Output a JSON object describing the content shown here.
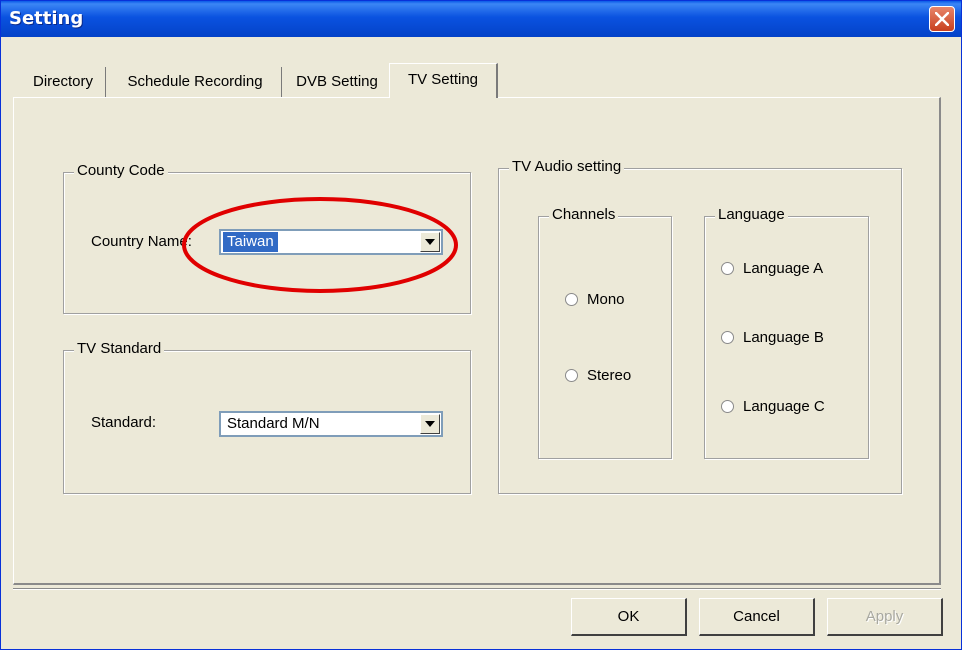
{
  "window": {
    "title": "Setting"
  },
  "tabs": [
    {
      "label": "Directory"
    },
    {
      "label": "Schedule Recording"
    },
    {
      "label": "DVB Setting"
    },
    {
      "label": "TV Setting",
      "active": true
    }
  ],
  "country_group": {
    "legend": "County Code",
    "country_label": "Country Name:",
    "country_value": "Taiwan"
  },
  "standard_group": {
    "legend": "TV Standard",
    "standard_label": "Standard:",
    "standard_value": "Standard M/N"
  },
  "audio_group": {
    "legend": "TV Audio setting",
    "channels": {
      "legend": "Channels",
      "options": [
        "Mono",
        "Stereo"
      ]
    },
    "language": {
      "legend": "Language",
      "options": [
        "Language A",
        "Language B",
        "Language C"
      ]
    }
  },
  "buttons": {
    "ok": "OK",
    "cancel": "Cancel",
    "apply": "Apply"
  },
  "colors": {
    "highlight": "#e00000",
    "selection": "#316ac5",
    "titlebar": "#0a52e0"
  },
  "icons": {
    "close": "close-icon",
    "dropdown": "chevron-down-icon"
  }
}
